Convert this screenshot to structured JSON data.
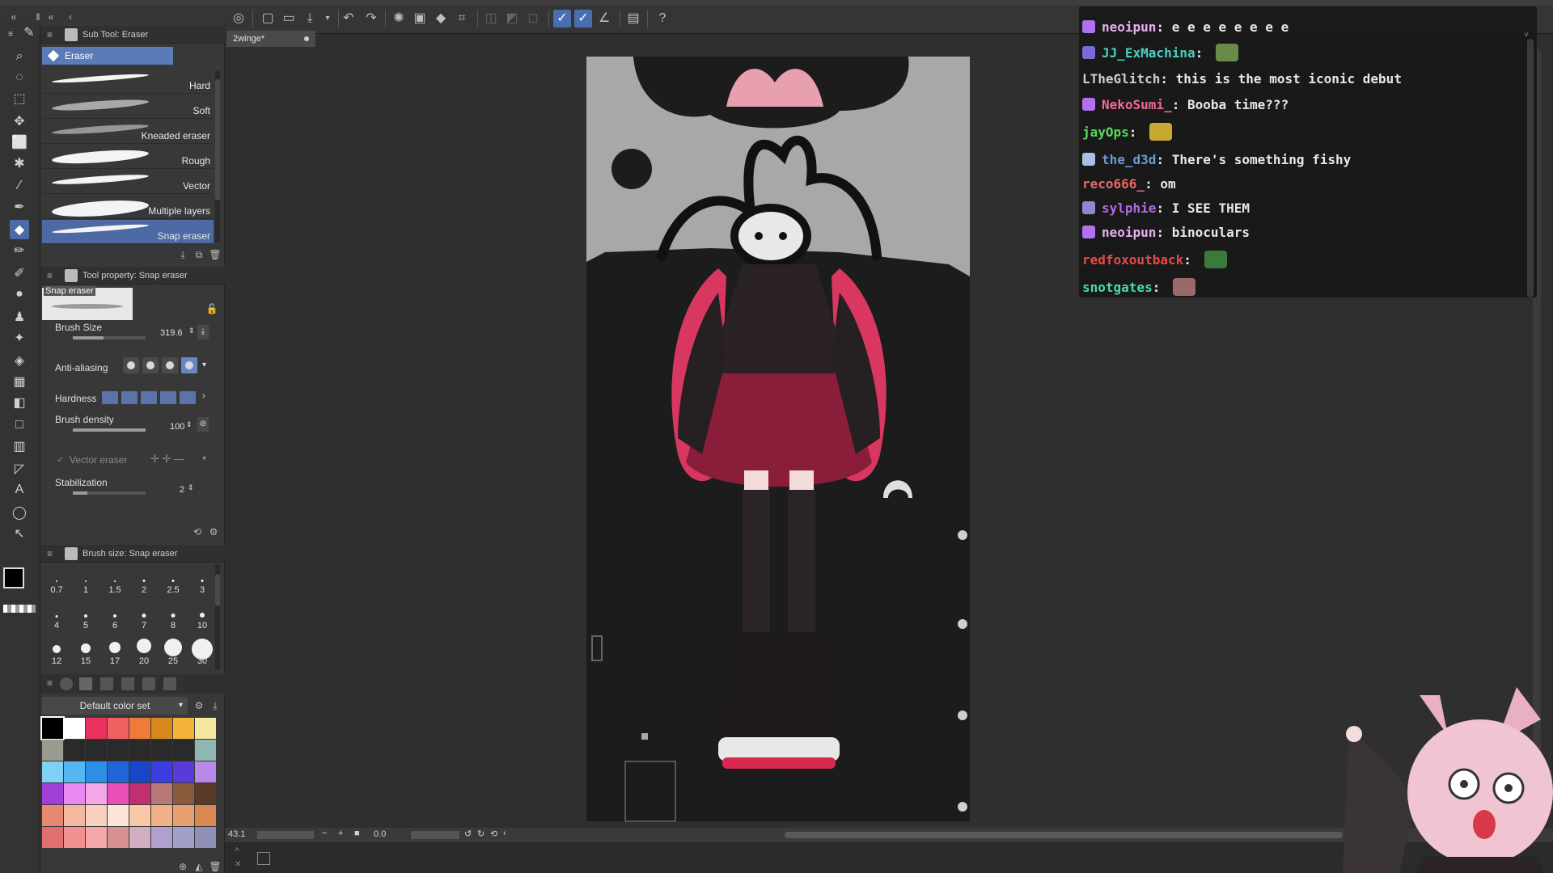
{
  "colors": {
    "accent": "#4b6aa6",
    "canvas_bg": "#2f2f2f",
    "panel_bg": "#383838",
    "character_pink": "#e8557a"
  },
  "document": {
    "tab_name": "2winge*"
  },
  "subtool": {
    "panel_title": "Sub Tool: Eraser",
    "active_group": "Eraser",
    "brushes": [
      {
        "label": "Hard"
      },
      {
        "label": "Soft"
      },
      {
        "label": "Kneaded eraser"
      },
      {
        "label": "Rough"
      },
      {
        "label": "Vector"
      },
      {
        "label": "Multiple layers"
      },
      {
        "label": "Snap eraser"
      }
    ],
    "selected_brush": "Snap eraser"
  },
  "tool_property": {
    "panel_title": "Tool property: Snap eraser",
    "preview_label": "Snap eraser",
    "brush_size": {
      "label": "Brush Size",
      "value": "319.6",
      "fill": 0.42
    },
    "anti_aliasing": {
      "label": "Anti-aliasing",
      "selected_index": 3
    },
    "hardness": {
      "label": "Hardness"
    },
    "brush_density": {
      "label": "Brush density",
      "value": "100",
      "fill": 1.0
    },
    "vector_eraser": {
      "label": "Vector eraser",
      "checked": true
    },
    "stabilization": {
      "label": "Stabilization",
      "value": "2",
      "fill": 0.2
    }
  },
  "brush_size_panel": {
    "panel_title": "Brush size: Snap eraser",
    "sizes": [
      "0.7",
      "1",
      "1.5",
      "2",
      "2.5",
      "3",
      "4",
      "5",
      "6",
      "7",
      "8",
      "10",
      "12",
      "15",
      "17",
      "20",
      "25",
      "30"
    ]
  },
  "color_set": {
    "name": "Default color set",
    "swatches": [
      "#000000",
      "#ffffff",
      "#e8315c",
      "#f06060",
      "#f07a3a",
      "#d8891e",
      "#f4b43a",
      "#f6e7a0",
      "#9a9a8e",
      "#2a2a2a",
      "#2a2a2a",
      "#2a2a2a",
      "#2a2a2a",
      "#2a2a2a",
      "#2a2a2a",
      "#8fb8b4",
      "#7fd0f4",
      "#56b6f4",
      "#2d8ee8",
      "#2066d8",
      "#1846c8",
      "#3c3ce0",
      "#5a3ad8",
      "#b88ae8",
      "#a040d8",
      "#e888f0",
      "#f4a8e8",
      "#e850b8",
      "#c03070",
      "#b87878",
      "#8a5a3a",
      "#5a3a24",
      "#e88870",
      "#f4b8a0",
      "#f8d0c0",
      "#fce4d8",
      "#f8c8a8",
      "#f0b088",
      "#e8a070",
      "#d88850",
      "#e07070",
      "#f09090",
      "#f4a8a8",
      "#d89090",
      "#d0b0c0",
      "#b0a0d0",
      "#a0a0c8",
      "#9090b8"
    ]
  },
  "canvas": {
    "zoom": "43.1",
    "rotation": "0.0"
  },
  "chat": {
    "messages": [
      {
        "user": "neoipun",
        "user_color": "#e8b0f0",
        "badge": "#b070f0",
        "text": "e e e e e e e e",
        "emote": null
      },
      {
        "user": "JJ_ExMachina",
        "user_color": "#4ad0c0",
        "badge": "#7a6ad8",
        "text": "",
        "emote": "#6a8a4a"
      },
      {
        "user": "LTheGlitch",
        "user_color": "#cfcfcf",
        "badge": null,
        "text": "this is the most iconic debut",
        "emote": null
      },
      {
        "user": "NekoSumi_",
        "user_color": "#f06a9a",
        "badge": "#b070f0",
        "text": "Booba time???",
        "emote": null
      },
      {
        "user": "jayOps",
        "user_color": "#5ad85a",
        "badge": null,
        "text": "",
        "emote": "#c8a830"
      },
      {
        "user": "the_d3d",
        "user_color": "#6a9ad8",
        "badge": "#a8c0e8",
        "text": "There's something fishy",
        "emote": null
      },
      {
        "user": "reco666_",
        "user_color": "#e86a6a",
        "badge": null,
        "text": "om",
        "emote": null
      },
      {
        "user": "sylphie",
        "user_color": "#b06ae8",
        "badge": "#8a8ad0",
        "text": "I SEE THEM",
        "emote": null
      },
      {
        "user": "neoipun",
        "user_color": "#e8b0f0",
        "badge": "#b070f0",
        "text": "binoculars",
        "emote": null
      },
      {
        "user": "redfoxoutback",
        "user_color": "#e84a4a",
        "badge": null,
        "text": "",
        "emote": "#3a7a3a"
      },
      {
        "user": "snotgates",
        "user_color": "#4ad8b0",
        "badge": null,
        "text": "",
        "emote": "#9a6a6a"
      }
    ]
  }
}
